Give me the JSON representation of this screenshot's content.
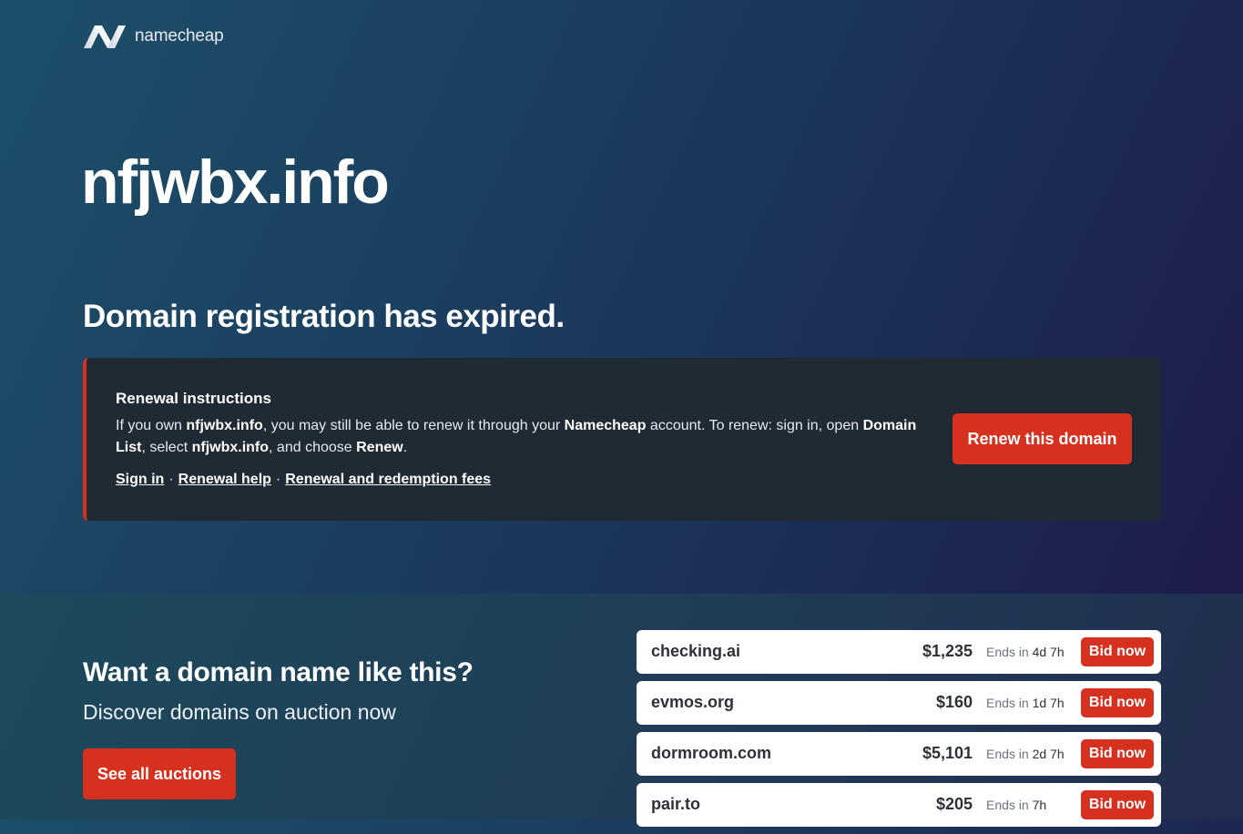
{
  "brand": {
    "name": "namecheap",
    "logo_icon": "namecheap-n-logo"
  },
  "domain": "nfjwbx.info",
  "status_heading": "Domain registration has expired.",
  "renewal": {
    "title": "Renewal instructions",
    "text_1": "If you own ",
    "domain": "nfjwbx.info",
    "text_2": ", you may still be able to renew it through your ",
    "brand": "Namecheap",
    "text_3": " account. To renew: sign in, open ",
    "domain_list": "Domain List",
    "text_4": ", select ",
    "domain_again": "nfjwbx.info",
    "text_5": ", and choose ",
    "renew_word": "Renew",
    "text_6": ".",
    "links": {
      "sign_in": "Sign in",
      "renewal_help": "Renewal help",
      "fees": "Renewal and redemption fees",
      "separator": "·"
    },
    "button": "Renew this domain"
  },
  "auctions_promo": {
    "heading": "Want a domain name like this?",
    "subheading": "Discover domains on auction now",
    "button": "See all auctions",
    "ends_label": "Ends in",
    "bid_label": "Bid now",
    "items": [
      {
        "name": "checking.ai",
        "price": "$1,235",
        "ends": "4d 7h"
      },
      {
        "name": "evmos.org",
        "price": "$160",
        "ends": "1d 7h"
      },
      {
        "name": "dormroom.com",
        "price": "$5,101",
        "ends": "2d 7h"
      },
      {
        "name": "pair.to",
        "price": "$205",
        "ends": "7h"
      }
    ]
  },
  "colors": {
    "accent": "#d6301f",
    "notice_bg": "#1f2a35"
  }
}
